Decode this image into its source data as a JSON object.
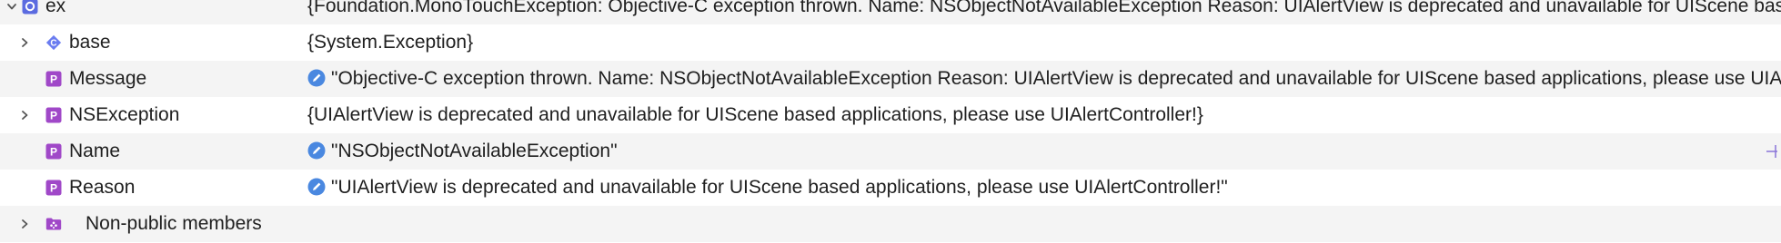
{
  "colors": {
    "property_badge": "#a048c8",
    "class_badge": "#6a7cf0",
    "pencil": "#4a88e0",
    "row_alt": "#f4f4f4"
  },
  "rows": [
    {
      "name": "ex",
      "icon": "object-icon",
      "value": "{Foundation.MonoTouchException: Objective-C exception thrown.  Name: NSObjectNotAvailableException Reason: UIAlertView is deprecated and unavailable for UIScene based applications, please use UIAlertController!}"
    },
    {
      "name": "base",
      "icon": "class-icon",
      "value": "{System.Exception}"
    },
    {
      "name": "Message",
      "icon": "property-icon",
      "value": "\"Objective-C exception thrown.  Name: NSObjectNotAvailableException Reason: UIAlertView is deprecated and unavailable for UIScene based applications, please use UIAlertController!\""
    },
    {
      "name": "NSException",
      "icon": "property-icon",
      "value": "{UIAlertView is deprecated and unavailable for UIScene based applications, please use UIAlertController!}"
    },
    {
      "name": "Name",
      "icon": "property-icon",
      "value": "\"NSObjectNotAvailableException\""
    },
    {
      "name": "Reason",
      "icon": "property-icon",
      "value": "\"UIAlertView is deprecated and unavailable for UIScene based applications, please use UIAlertController!\""
    },
    {
      "name": "Non-public members",
      "icon": "non-public-members-icon",
      "value": ""
    }
  ]
}
